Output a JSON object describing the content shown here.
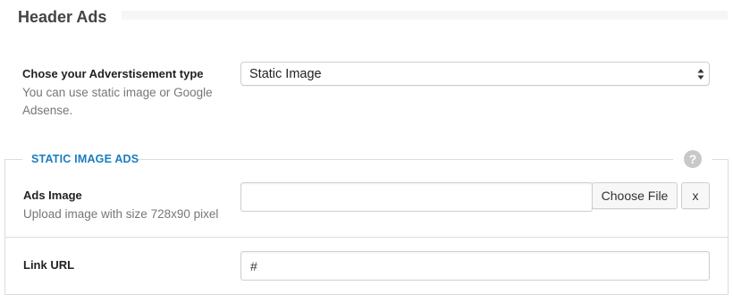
{
  "section": {
    "title": "Header Ads"
  },
  "ad_type": {
    "label": "Chose your Adverstisement type",
    "description": "You can use static image or Google Adsense.",
    "selected": "Static Image"
  },
  "static_ads": {
    "legend": "STATIC IMAGE ADS",
    "help_icon": "?",
    "image": {
      "label": "Ads Image",
      "description": "Upload image with size 728x90 pixel",
      "value": "",
      "choose_button": "Choose File",
      "remove_button": "x"
    },
    "link": {
      "label": "Link URL",
      "value": "#"
    }
  },
  "colors": {
    "legend": "#1a7cbf",
    "help_icon_bg": "#c8c8c8"
  }
}
